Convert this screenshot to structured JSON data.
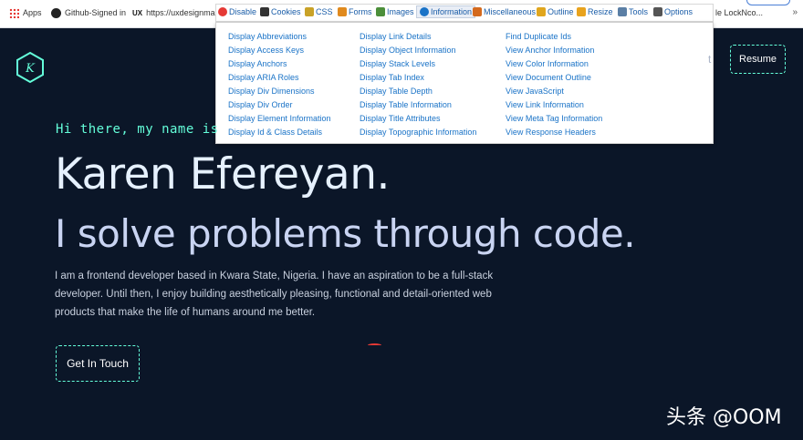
{
  "browser": {
    "bookmarks": [
      {
        "label": "Apps",
        "icon": "apps-grid-icon"
      },
      {
        "label": "Github-Signed in",
        "icon": "github-icon"
      },
      {
        "label": "https://uxdesignma...",
        "icon": "ux-icon",
        "icon_text": "UX"
      },
      {
        "label": "le LockNco..."
      }
    ],
    "overflow_glyph": "»"
  },
  "webdev_toolbar": {
    "items": [
      {
        "label": "Disable",
        "icon": "disable-icon",
        "color": "#e53935"
      },
      {
        "label": "Cookies",
        "icon": "cookies-icon",
        "color": "#333333"
      },
      {
        "label": "CSS",
        "icon": "css-icon",
        "color": "#c9a227"
      },
      {
        "label": "Forms",
        "icon": "forms-icon",
        "color": "#e08a1e"
      },
      {
        "label": "Images",
        "icon": "images-icon",
        "color": "#4c8f3a"
      },
      {
        "label": "Information",
        "icon": "information-icon",
        "color": "#1a73c7",
        "active": true
      },
      {
        "label": "Miscellaneous",
        "icon": "miscellaneous-icon",
        "color": "#d46a1e"
      },
      {
        "label": "Outline",
        "icon": "outline-icon",
        "color": "#e0a61e"
      },
      {
        "label": "Resize",
        "icon": "resize-icon",
        "color": "#e8a31e"
      },
      {
        "label": "Tools",
        "icon": "tools-icon",
        "color": "#5b7fa5"
      },
      {
        "label": "Options",
        "icon": "options-icon",
        "color": "#555555"
      }
    ]
  },
  "info_menu": {
    "col1": [
      "Display Abbreviations",
      "Display Access Keys",
      "Display Anchors",
      "Display ARIA Roles",
      "Display Div Dimensions",
      "Display Div Order",
      "Display Element Information",
      "Display Id & Class Details"
    ],
    "col2": [
      "Display Link Details",
      "Display Object Information",
      "Display Stack Levels",
      "Display Tab Index",
      "Display Table Depth",
      "Display Table Information",
      "Display Title Attributes",
      "Display Topographic Information"
    ],
    "col3": [
      "Find Duplicate Ids",
      "View Anchor Information",
      "View Color Information",
      "View Document Outline",
      "View JavaScript",
      "View Link Information",
      "View Meta Tag Information",
      "View Response Headers"
    ]
  },
  "site": {
    "logo_letter": "K",
    "nav_partial": "t",
    "resume_label": "Resume",
    "greeting": "Hi there, my name is",
    "name": "Karen Efereyan.",
    "tagline": "I solve problems through code.",
    "bio": "I am a frontend developer based in Kwara State, Nigeria. I have an aspiration to be a full-stack developer. Until then, I enjoy building aesthetically pleasing, functional and detail-oriented web products that make the life of humans around me better.",
    "cta_label": "Get In Touch",
    "accent_color": "#64ffda",
    "background_color": "#0b1628"
  },
  "watermark": "头条 @OOM"
}
